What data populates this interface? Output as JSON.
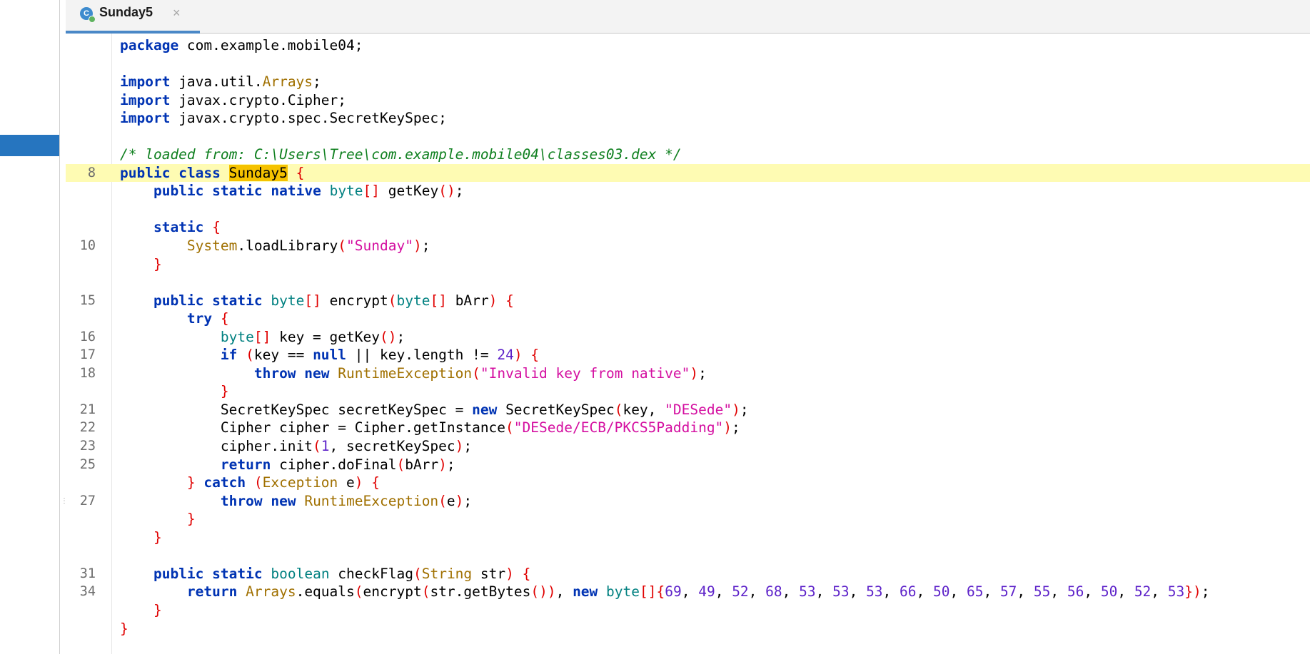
{
  "tab": {
    "title": "Sunday5",
    "close": "×",
    "icon": "class-icon"
  },
  "lines": [
    {
      "num": "",
      "hl": false,
      "tokens": [
        {
          "t": "package",
          "c": "kw"
        },
        {
          "t": " com.example.mobile04;"
        }
      ]
    },
    {
      "num": "",
      "hl": false,
      "tokens": []
    },
    {
      "num": "",
      "hl": false,
      "tokens": [
        {
          "t": "import",
          "c": "kw"
        },
        {
          "t": " java.util."
        },
        {
          "t": "Arrays",
          "c": "cls"
        },
        {
          "t": ";"
        }
      ]
    },
    {
      "num": "",
      "hl": false,
      "tokens": [
        {
          "t": "import",
          "c": "kw"
        },
        {
          "t": " javax.crypto.Cipher;"
        }
      ]
    },
    {
      "num": "",
      "hl": false,
      "tokens": [
        {
          "t": "import",
          "c": "kw"
        },
        {
          "t": " javax.crypto.spec.SecretKeySpec;"
        }
      ]
    },
    {
      "num": "",
      "hl": false,
      "tokens": []
    },
    {
      "num": "",
      "hl": false,
      "tokens": [
        {
          "t": "/* loaded from: C:\\Users\\Tree\\com.example.mobile04\\classes03.dex */",
          "c": "cm"
        }
      ]
    },
    {
      "num": "8",
      "hl": true,
      "tokens": [
        {
          "t": "public",
          "c": "kw"
        },
        {
          "t": " "
        },
        {
          "t": "class",
          "c": "kw"
        },
        {
          "t": " "
        },
        {
          "t": "Sunday5",
          "c": "sel"
        },
        {
          "t": " "
        },
        {
          "t": "{",
          "c": "br"
        }
      ]
    },
    {
      "num": "",
      "hl": false,
      "tokens": [
        {
          "t": "    "
        },
        {
          "t": "public",
          "c": "kw"
        },
        {
          "t": " "
        },
        {
          "t": "static",
          "c": "kw"
        },
        {
          "t": " "
        },
        {
          "t": "native",
          "c": "kw"
        },
        {
          "t": " "
        },
        {
          "t": "byte",
          "c": "ty"
        },
        {
          "t": "[]",
          "c": "br"
        },
        {
          "t": " getKey"
        },
        {
          "t": "()",
          "c": "br"
        },
        {
          "t": ";"
        }
      ]
    },
    {
      "num": "",
      "hl": false,
      "tokens": []
    },
    {
      "num": "",
      "hl": false,
      "tokens": [
        {
          "t": "    "
        },
        {
          "t": "static",
          "c": "kw"
        },
        {
          "t": " "
        },
        {
          "t": "{",
          "c": "br"
        }
      ]
    },
    {
      "num": "10",
      "hl": false,
      "tokens": [
        {
          "t": "        "
        },
        {
          "t": "System",
          "c": "cls"
        },
        {
          "t": ".loadLibrary"
        },
        {
          "t": "(",
          "c": "br"
        },
        {
          "t": "\"Sunday\"",
          "c": "str"
        },
        {
          "t": ")",
          "c": "br"
        },
        {
          "t": ";"
        }
      ]
    },
    {
      "num": "",
      "hl": false,
      "tokens": [
        {
          "t": "    "
        },
        {
          "t": "}",
          "c": "br"
        }
      ]
    },
    {
      "num": "",
      "hl": false,
      "tokens": []
    },
    {
      "num": "15",
      "hl": false,
      "tokens": [
        {
          "t": "    "
        },
        {
          "t": "public",
          "c": "kw"
        },
        {
          "t": " "
        },
        {
          "t": "static",
          "c": "kw"
        },
        {
          "t": " "
        },
        {
          "t": "byte",
          "c": "ty"
        },
        {
          "t": "[]",
          "c": "br"
        },
        {
          "t": " encrypt"
        },
        {
          "t": "(",
          "c": "br"
        },
        {
          "t": "byte",
          "c": "ty"
        },
        {
          "t": "[]",
          "c": "br"
        },
        {
          "t": " bArr"
        },
        {
          "t": ")",
          "c": "br"
        },
        {
          "t": " "
        },
        {
          "t": "{",
          "c": "br"
        }
      ]
    },
    {
      "num": "",
      "hl": false,
      "tokens": [
        {
          "t": "        "
        },
        {
          "t": "try",
          "c": "kw"
        },
        {
          "t": " "
        },
        {
          "t": "{",
          "c": "br"
        }
      ]
    },
    {
      "num": "16",
      "hl": false,
      "tokens": [
        {
          "t": "            "
        },
        {
          "t": "byte",
          "c": "ty"
        },
        {
          "t": "[]",
          "c": "br"
        },
        {
          "t": " key = getKey"
        },
        {
          "t": "()",
          "c": "br"
        },
        {
          "t": ";"
        }
      ]
    },
    {
      "num": "17",
      "hl": false,
      "tokens": [
        {
          "t": "            "
        },
        {
          "t": "if",
          "c": "kw"
        },
        {
          "t": " "
        },
        {
          "t": "(",
          "c": "br"
        },
        {
          "t": "key == "
        },
        {
          "t": "null",
          "c": "kw"
        },
        {
          "t": " || key.length != "
        },
        {
          "t": "24",
          "c": "num"
        },
        {
          "t": ")",
          "c": "br"
        },
        {
          "t": " "
        },
        {
          "t": "{",
          "c": "br"
        }
      ]
    },
    {
      "num": "18",
      "hl": false,
      "tokens": [
        {
          "t": "                "
        },
        {
          "t": "throw",
          "c": "kw"
        },
        {
          "t": " "
        },
        {
          "t": "new",
          "c": "kw"
        },
        {
          "t": " "
        },
        {
          "t": "RuntimeException",
          "c": "cls"
        },
        {
          "t": "(",
          "c": "br"
        },
        {
          "t": "\"Invalid key from native\"",
          "c": "str"
        },
        {
          "t": ")",
          "c": "br"
        },
        {
          "t": ";"
        }
      ]
    },
    {
      "num": "",
      "hl": false,
      "tokens": [
        {
          "t": "            "
        },
        {
          "t": "}",
          "c": "br"
        }
      ]
    },
    {
      "num": "21",
      "hl": false,
      "tokens": [
        {
          "t": "            SecretKeySpec secretKeySpec = "
        },
        {
          "t": "new",
          "c": "kw"
        },
        {
          "t": " SecretKeySpec"
        },
        {
          "t": "(",
          "c": "br"
        },
        {
          "t": "key, "
        },
        {
          "t": "\"DESede\"",
          "c": "str"
        },
        {
          "t": ")",
          "c": "br"
        },
        {
          "t": ";"
        }
      ]
    },
    {
      "num": "22",
      "hl": false,
      "tokens": [
        {
          "t": "            Cipher cipher = Cipher.getInstance"
        },
        {
          "t": "(",
          "c": "br"
        },
        {
          "t": "\"DESede/ECB/PKCS5Padding\"",
          "c": "str"
        },
        {
          "t": ")",
          "c": "br"
        },
        {
          "t": ";"
        }
      ]
    },
    {
      "num": "23",
      "hl": false,
      "tokens": [
        {
          "t": "            cipher.init"
        },
        {
          "t": "(",
          "c": "br"
        },
        {
          "t": "1",
          "c": "num"
        },
        {
          "t": ", secretKeySpec"
        },
        {
          "t": ")",
          "c": "br"
        },
        {
          "t": ";"
        }
      ]
    },
    {
      "num": "25",
      "hl": false,
      "tokens": [
        {
          "t": "            "
        },
        {
          "t": "return",
          "c": "kw"
        },
        {
          "t": " cipher.doFinal"
        },
        {
          "t": "(",
          "c": "br"
        },
        {
          "t": "bArr"
        },
        {
          "t": ")",
          "c": "br"
        },
        {
          "t": ";"
        }
      ]
    },
    {
      "num": "",
      "hl": false,
      "tokens": [
        {
          "t": "        "
        },
        {
          "t": "}",
          "c": "br"
        },
        {
          "t": " "
        },
        {
          "t": "catch",
          "c": "kw"
        },
        {
          "t": " "
        },
        {
          "t": "(",
          "c": "br"
        },
        {
          "t": "Exception",
          "c": "cls"
        },
        {
          "t": " e"
        },
        {
          "t": ")",
          "c": "br"
        },
        {
          "t": " "
        },
        {
          "t": "{",
          "c": "br"
        }
      ]
    },
    {
      "num": "27",
      "hl": false,
      "tokens": [
        {
          "t": "            "
        },
        {
          "t": "throw",
          "c": "kw"
        },
        {
          "t": " "
        },
        {
          "t": "new",
          "c": "kw"
        },
        {
          "t": " "
        },
        {
          "t": "RuntimeException",
          "c": "cls"
        },
        {
          "t": "(",
          "c": "br"
        },
        {
          "t": "e"
        },
        {
          "t": ")",
          "c": "br"
        },
        {
          "t": ";"
        }
      ]
    },
    {
      "num": "",
      "hl": false,
      "tokens": [
        {
          "t": "        "
        },
        {
          "t": "}",
          "c": "br"
        }
      ]
    },
    {
      "num": "",
      "hl": false,
      "tokens": [
        {
          "t": "    "
        },
        {
          "t": "}",
          "c": "br"
        }
      ]
    },
    {
      "num": "",
      "hl": false,
      "tokens": []
    },
    {
      "num": "31",
      "hl": false,
      "tokens": [
        {
          "t": "    "
        },
        {
          "t": "public",
          "c": "kw"
        },
        {
          "t": " "
        },
        {
          "t": "static",
          "c": "kw"
        },
        {
          "t": " "
        },
        {
          "t": "boolean",
          "c": "ty"
        },
        {
          "t": " checkFlag"
        },
        {
          "t": "(",
          "c": "br"
        },
        {
          "t": "String",
          "c": "cls"
        },
        {
          "t": " str"
        },
        {
          "t": ")",
          "c": "br"
        },
        {
          "t": " "
        },
        {
          "t": "{",
          "c": "br"
        }
      ]
    },
    {
      "num": "34",
      "hl": false,
      "tokens": [
        {
          "t": "        "
        },
        {
          "t": "return",
          "c": "kw"
        },
        {
          "t": " "
        },
        {
          "t": "Arrays",
          "c": "cls"
        },
        {
          "t": ".equals"
        },
        {
          "t": "(",
          "c": "br"
        },
        {
          "t": "encrypt"
        },
        {
          "t": "(",
          "c": "br"
        },
        {
          "t": "str.getBytes"
        },
        {
          "t": "())",
          "c": "br"
        },
        {
          "t": ", "
        },
        {
          "t": "new",
          "c": "kw"
        },
        {
          "t": " "
        },
        {
          "t": "byte",
          "c": "ty"
        },
        {
          "t": "[]",
          "c": "br"
        },
        {
          "t": "{",
          "c": "br"
        },
        {
          "t": "69",
          "c": "num"
        },
        {
          "t": ", "
        },
        {
          "t": "49",
          "c": "num"
        },
        {
          "t": ", "
        },
        {
          "t": "52",
          "c": "num"
        },
        {
          "t": ", "
        },
        {
          "t": "68",
          "c": "num"
        },
        {
          "t": ", "
        },
        {
          "t": "53",
          "c": "num"
        },
        {
          "t": ", "
        },
        {
          "t": "53",
          "c": "num"
        },
        {
          "t": ", "
        },
        {
          "t": "53",
          "c": "num"
        },
        {
          "t": ", "
        },
        {
          "t": "66",
          "c": "num"
        },
        {
          "t": ", "
        },
        {
          "t": "50",
          "c": "num"
        },
        {
          "t": ", "
        },
        {
          "t": "65",
          "c": "num"
        },
        {
          "t": ", "
        },
        {
          "t": "57",
          "c": "num"
        },
        {
          "t": ", "
        },
        {
          "t": "55",
          "c": "num"
        },
        {
          "t": ", "
        },
        {
          "t": "56",
          "c": "num"
        },
        {
          "t": ", "
        },
        {
          "t": "50",
          "c": "num"
        },
        {
          "t": ", "
        },
        {
          "t": "52",
          "c": "num"
        },
        {
          "t": ", "
        },
        {
          "t": "53",
          "c": "num"
        },
        {
          "t": "})",
          "c": "br"
        },
        {
          "t": ";"
        }
      ]
    },
    {
      "num": "",
      "hl": false,
      "tokens": [
        {
          "t": "    "
        },
        {
          "t": "}",
          "c": "br"
        }
      ]
    },
    {
      "num": "",
      "hl": false,
      "tokens": [
        {
          "t": "}",
          "c": "br"
        }
      ]
    }
  ],
  "colors": {
    "keyword": "#0033b3",
    "type": "#008080",
    "class": "#a07000",
    "string": "#d40ea0",
    "number": "#5d22c9",
    "comment": "#108020",
    "bracket": "#e00000",
    "line_highlight": "#fefbb3",
    "selection": "#f5c200",
    "tab_accent": "#4a88c7"
  }
}
